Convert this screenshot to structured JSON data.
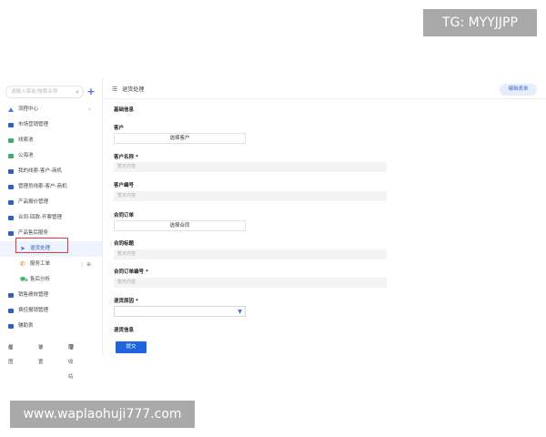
{
  "watermarks": {
    "top": "TG: MYYJJPP",
    "bottom": "www.waplaohuji777.com"
  },
  "sidebar": {
    "search_placeholder": "请输入菜单/搜索名称",
    "items": [
      {
        "label": "流程中心",
        "icon": "people-icon",
        "has_chevron": true
      },
      {
        "label": "市场营销管理",
        "icon": "folder-icon"
      },
      {
        "label": "线索池",
        "icon": "shield-icon"
      },
      {
        "label": "公海池",
        "icon": "calendar-icon"
      },
      {
        "label": "我的线索-客户-商机",
        "icon": "folder-icon"
      },
      {
        "label": "管理员线索-客户-商机",
        "icon": "folder-icon"
      },
      {
        "label": "产品报价管理",
        "icon": "folder-icon"
      },
      {
        "label": "合同-回款-开票管理",
        "icon": "folder-icon"
      },
      {
        "label": "产品售后服务",
        "icon": "folder-icon"
      },
      {
        "label": "退货处理",
        "icon": "send-icon",
        "active": true
      },
      {
        "label": "服务工单",
        "icon": "phone-icon"
      },
      {
        "label": "售后分析",
        "icon": "cart-icon"
      },
      {
        "label": "销售绩效管理",
        "icon": "folder-icon"
      },
      {
        "label": "费控报销管理",
        "icon": "folder-icon"
      },
      {
        "label": "辅助表",
        "icon": "folder-icon"
      }
    ],
    "footer": {
      "view": "视图",
      "settings": "设置",
      "recycle": "回收站"
    }
  },
  "main": {
    "breadcrumb": "退货处理",
    "edit_button": "编辑表单",
    "section_title": "基础信息",
    "fields": {
      "customer_label": "客户",
      "customer_pick": "选择客户",
      "customer_name_label": "客户名称",
      "customer_name_placeholder": "暂无内容",
      "customer_no_label": "客户编号",
      "customer_no_placeholder": "暂无内容",
      "contract_label": "合同订单",
      "contract_pick": "选择合同",
      "contract_title_label": "合同标题",
      "contract_title_placeholder": "暂无内容",
      "contract_no_label": "合同订单编号",
      "contract_no_placeholder": "暂无内容",
      "reason_label": "退货原因",
      "info_label": "退货信息"
    },
    "submit": "提交"
  }
}
